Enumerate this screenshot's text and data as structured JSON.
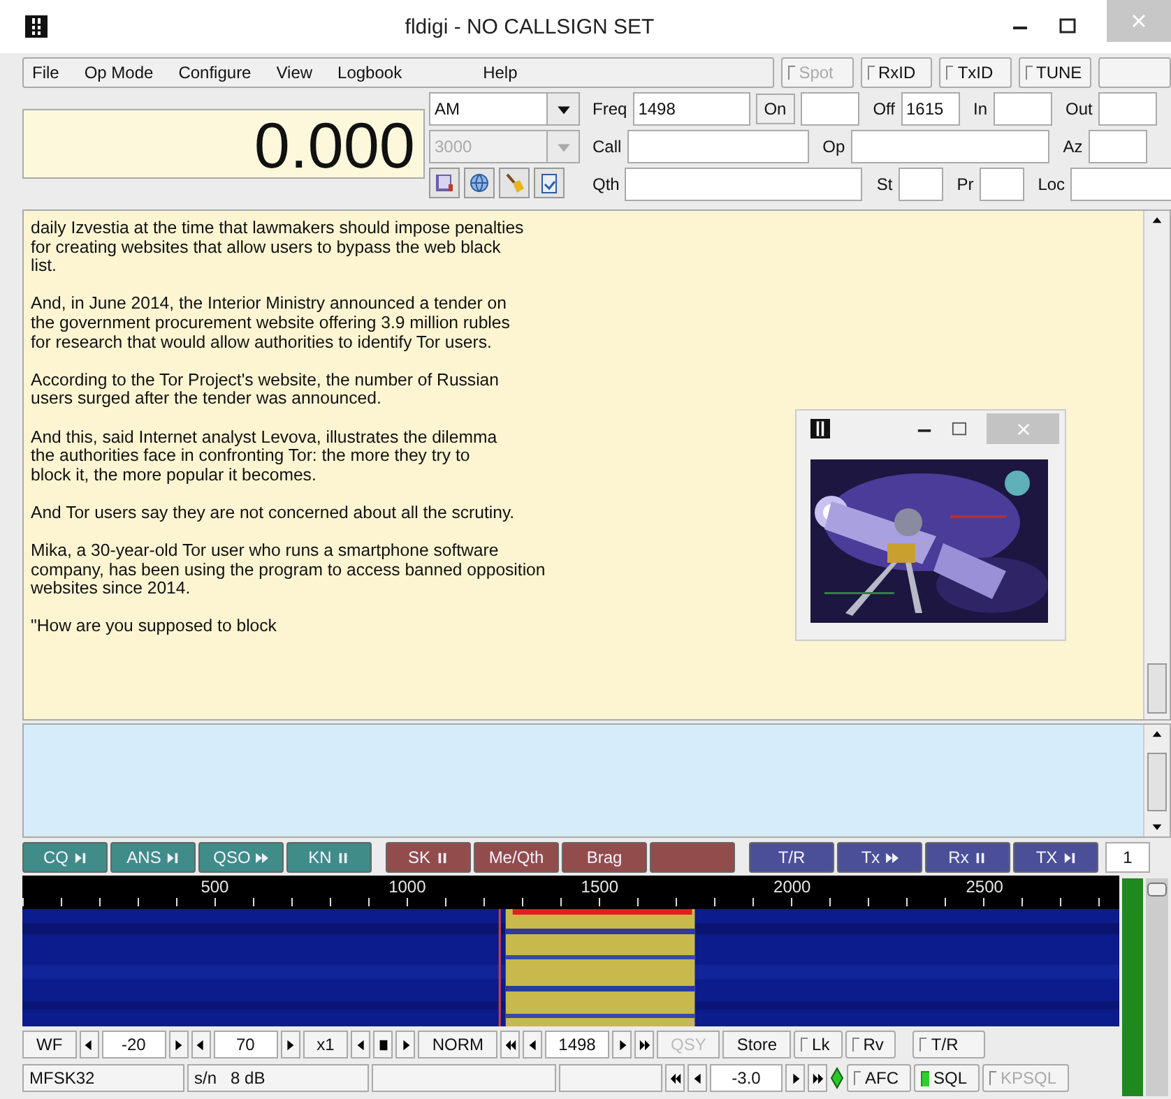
{
  "window": {
    "title": "fldigi - NO CALLSIGN SET"
  },
  "menu": [
    {
      "label": "File"
    },
    {
      "label": "Op Mode"
    },
    {
      "label": "Configure"
    },
    {
      "label": "View"
    },
    {
      "label": "Logbook"
    },
    {
      "label": "Help"
    }
  ],
  "top_toggles": [
    {
      "label": "Spot",
      "checked": false,
      "disabled": true
    },
    {
      "label": "RxID",
      "checked": false,
      "disabled": false
    },
    {
      "label": "TxID",
      "checked": false,
      "disabled": false
    },
    {
      "label": "TUNE",
      "checked": false,
      "disabled": false
    }
  ],
  "frequency_display": "0.000",
  "mode": {
    "value": "AM",
    "disabled": false
  },
  "bandwidth": {
    "value": "3000",
    "disabled": true
  },
  "log_rows": [
    [
      {
        "kind": "field",
        "label": "Freq",
        "value": "1498"
      },
      {
        "kind": "button",
        "label": "On"
      },
      {
        "kind": "field"
      },
      {
        "kind": "field",
        "label": "Off",
        "value": "1615"
      },
      {
        "kind": "field",
        "label": "In"
      },
      {
        "kind": "field",
        "label": "Out"
      }
    ],
    [
      {
        "kind": "field",
        "label": "Call"
      },
      {
        "kind": "field",
        "label": "Op"
      },
      {
        "kind": "field",
        "label": "Az"
      }
    ],
    [
      {
        "kind": "field",
        "label": "Qth"
      },
      {
        "kind": "field",
        "label": "St"
      },
      {
        "kind": "field",
        "label": "Pr"
      },
      {
        "kind": "field",
        "label": "Loc"
      }
    ]
  ],
  "receive_text": [
    [
      "daily Izvestia at the time that lawmakers should impose penalties",
      "for creating websites that allow users to bypass the web black",
      "list."
    ],
    [
      "And, in June 2014, the Interior Ministry announced a tender on",
      "the government procurement website offering 3.9 million rubles",
      "for research that would allow authorities to identify Tor users."
    ],
    [
      "According to the Tor Project's website, the number of Russian",
      "users surged after the tender was announced."
    ],
    [
      "And this, said Internet analyst Levova, illustrates the dilemma",
      "the authorities face in confronting Tor: the more they try to",
      "block it, the more popular it becomes."
    ],
    [
      "And Tor users say they are not concerned about all the scrutiny."
    ],
    [
      "Mika, a 30-year-old Tor user who runs a smartphone software",
      "company, has been using the program to access banned opposition",
      "websites since 2014."
    ],
    [
      "\"How are you supposed to block"
    ]
  ],
  "image_window": {
    "kind": "picture"
  },
  "macros": [
    {
      "label": "CQ",
      "color": "#3f8c88"
    },
    {
      "label": "ANS",
      "color": "#3f8c88"
    },
    {
      "label": "QSO",
      "color": "#3f8c88"
    },
    {
      "label": "KN",
      "color": "#3f8c88"
    },
    {
      "label": "SK",
      "color": "#934c4c"
    },
    {
      "label": "Me/Qth",
      "color": "#934c4c"
    },
    {
      "label": "Brag",
      "color": "#934c4c"
    },
    {
      "color": "#934c4c"
    },
    {
      "label": "T/R",
      "color": "#4b4f98"
    },
    {
      "label": "Tx",
      "color": "#4b4f98"
    },
    {
      "label": "Rx",
      "color": "#4b4f98"
    },
    {
      "label": "TX",
      "color": "#4b4f98"
    }
  ],
  "macro_page": "1",
  "waterfall": {
    "scale": [
      "500",
      "1000",
      "1500",
      "2000",
      "2500"
    ]
  },
  "signal_meter": {
    "level": 1
  },
  "squelch": {
    "level": 0.98
  },
  "tuning_bar": [
    {
      "kind": "button",
      "label": "WF",
      "disabled": false
    },
    {
      "kind": "arrow"
    },
    {
      "kind": "field",
      "value": "-20"
    },
    {
      "kind": "arrow"
    },
    {
      "kind": "arrow"
    },
    {
      "kind": "field",
      "value": "70"
    },
    {
      "kind": "arrow"
    },
    {
      "kind": "button",
      "label": "x1",
      "disabled": false
    },
    {
      "kind": "arrow"
    },
    {
      "kind": "arrow"
    },
    {
      "kind": "arrow"
    },
    {
      "kind": "button",
      "label": "NORM",
      "disabled": false
    },
    {
      "kind": "arrow"
    },
    {
      "kind": "arrow"
    },
    {
      "kind": "field",
      "value": "1498"
    },
    {
      "kind": "arrow"
    },
    {
      "kind": "arrow"
    },
    {
      "kind": "button",
      "label": "QSY",
      "disabled": true
    },
    {
      "kind": "button",
      "label": "Store",
      "disabled": false
    },
    {
      "kind": "toggle",
      "label": "Lk",
      "checked": false,
      "disabled": false
    },
    {
      "kind": "toggle",
      "label": "Rv",
      "checked": false,
      "disabled": false
    },
    {
      "kind": "toggle",
      "label": "T/R",
      "checked": false,
      "disabled": false
    }
  ],
  "status_bar": [
    {
      "kind": "text",
      "label": "MFSK32"
    },
    {
      "kind": "text",
      "label": "s/n   8 dB"
    },
    {
      "kind": "text"
    },
    {
      "kind": "text"
    },
    {
      "kind": "arrow"
    },
    {
      "kind": "arrow"
    },
    {
      "kind": "field",
      "value": "-3.0"
    },
    {
      "kind": "arrow"
    },
    {
      "kind": "arrow"
    },
    {
      "kind": "diamond",
      "on": true
    },
    {
      "kind": "toggle",
      "label": "AFC",
      "checked": false,
      "disabled": false
    },
    {
      "kind": "toggle",
      "label": "SQL",
      "checked": true,
      "disabled": false
    },
    {
      "kind": "toggle",
      "label": "KPSQL",
      "checked": false,
      "disabled": true
    }
  ]
}
